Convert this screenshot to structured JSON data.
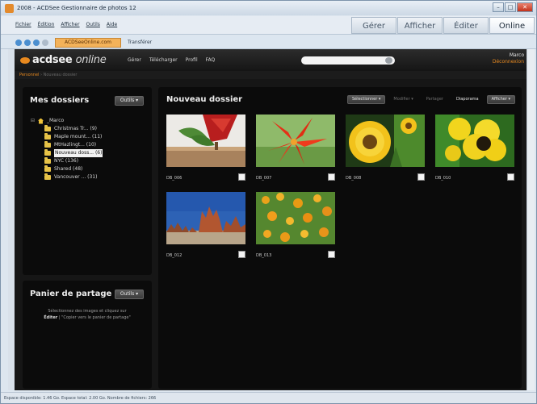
{
  "window": {
    "title": "2008 - ACDSee Gestionnaire de photos 12",
    "controls": {
      "minimize": "–",
      "maximize": "□",
      "close": "✕"
    }
  },
  "menu": {
    "items": [
      "Fichier",
      "Édition",
      "Afficher",
      "Outils",
      "Aide"
    ]
  },
  "modes": [
    "Gérer",
    "Afficher",
    "Éditer",
    "Online"
  ],
  "nav": {
    "tab_active": "ACDSeeOnline.com",
    "tab_other": "Transférer"
  },
  "site": {
    "logo_brand": "acdsee",
    "logo_suffix": "online",
    "nav_items": [
      "Gérer",
      "Télécharger",
      "Profil",
      "FAQ"
    ],
    "search": {
      "placeholder": "",
      "value": ""
    },
    "user_name": "Marco",
    "logout": "Déconnexion",
    "breadcrumb_link": "Personnel",
    "breadcrumb_current": "Nouveau dossier"
  },
  "folders_panel": {
    "title": "Mes dossiers",
    "tools_label": "Outils ▾",
    "root": "_Marco",
    "items": [
      {
        "label": "Christmas Tr... (9)"
      },
      {
        "label": "Maple mount... (11)"
      },
      {
        "label": "MtHazlingt... (10)"
      },
      {
        "label": "Nouveau doss... (6)",
        "selected": true
      },
      {
        "label": "NYC (136)"
      },
      {
        "label": "Shared (48)"
      },
      {
        "label": "Vancouver ... (31)"
      }
    ]
  },
  "share_panel": {
    "title": "Panier de partage",
    "tools_label": "Outils ▾",
    "text_before": "Sélectionnez des images et cliquez sur",
    "text_bold": "Éditer",
    "text_after": "| \"Copier vers le panier de partage\""
  },
  "content": {
    "title": "Nouveau dossier",
    "toolbar": {
      "select": "Sélectionner ▾",
      "edit": "Modifier ▾",
      "share": "Partager",
      "slideshow": "Diaporama",
      "view": "Afficher ▾"
    },
    "photos": [
      {
        "caption": "DB_006",
        "scene": "red-flower-pot"
      },
      {
        "caption": "DB_007",
        "scene": "red-lily"
      },
      {
        "caption": "DB_008",
        "scene": "sunflower"
      },
      {
        "caption": "DB_010",
        "scene": "pansy"
      },
      {
        "caption": "DB_012",
        "scene": "rock-formations"
      },
      {
        "caption": "DB_013",
        "scene": "orange-flowers"
      }
    ]
  },
  "status": "Espace disponible: 1.46 Go. Espace total: 2.00 Go. Nombre de fichiers: 266"
}
